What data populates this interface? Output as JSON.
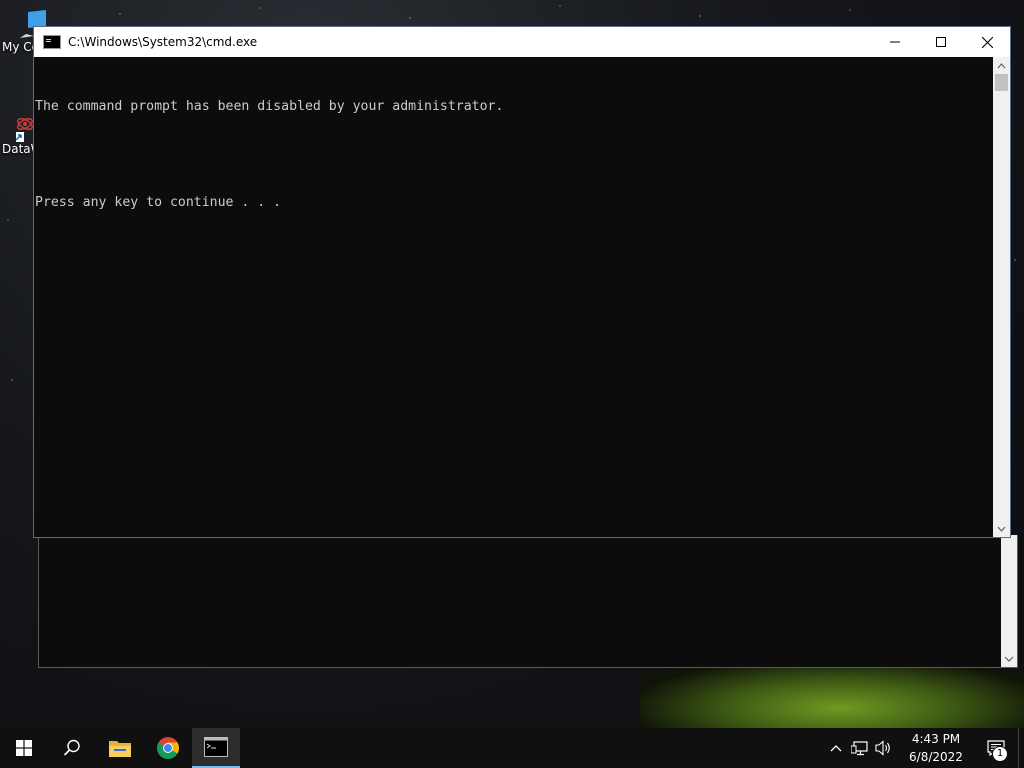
{
  "desktop": {
    "icons": [
      {
        "label": "My Co",
        "icon": "computer-icon"
      },
      {
        "label": "DataW",
        "icon": "datawrapper-shortcut-icon"
      }
    ]
  },
  "window": {
    "title": "C:\\Windows\\System32\\cmd.exe",
    "console_lines": [
      "The command prompt has been disabled by your administrator.",
      "",
      "Press any key to continue . . ."
    ]
  },
  "taskbar": {
    "apps": [
      "start-icon",
      "search-icon",
      "file-explorer-icon",
      "chrome-icon",
      "cmd-icon"
    ],
    "active_app": "cmd-icon",
    "clock": {
      "time": "4:43 PM",
      "date": "6/8/2022"
    },
    "notifications_count": "1"
  },
  "colors": {
    "console_bg": "#0c0c0c",
    "console_text": "#cccccc",
    "taskbar_bg": "#101010",
    "accent": "#76b9ed"
  }
}
